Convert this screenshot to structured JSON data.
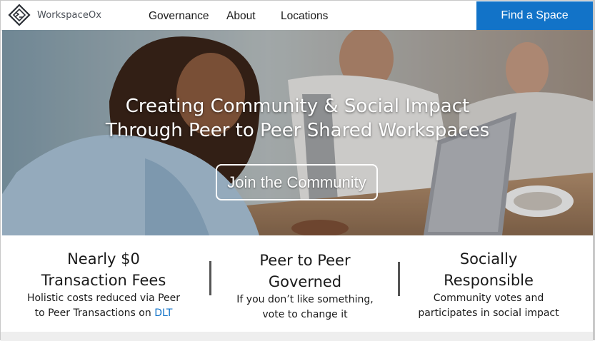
{
  "brand": {
    "name": "WorkspaceOx"
  },
  "nav": {
    "links": [
      "Governance",
      "About",
      "Locations"
    ],
    "cta_label": "Find a Space"
  },
  "hero": {
    "title_line1": "Creating Community & Social Impact",
    "title_line2": "Through Peer to Peer Shared Workspaces",
    "button_label": "Join the Community"
  },
  "features": [
    {
      "title_line1": "Nearly $0",
      "title_line2": "Transaction Fees",
      "desc_line1": "Holistic costs reduced via Peer",
      "desc_line2_prefix": "to Peer Transactions on ",
      "desc_line2_link": "DLT"
    },
    {
      "title_line1": "Peer to Peer",
      "title_line2": "Governed",
      "desc_line1": "If you don’t like something,",
      "desc_line2": "vote to change it"
    },
    {
      "title_line1": "Socially",
      "title_line2": "Responsible",
      "desc_line1": "Community votes and",
      "desc_line2": "participates in social impact"
    }
  ],
  "colors": {
    "accent": "#1273c8",
    "text": "#1a1a1a"
  }
}
